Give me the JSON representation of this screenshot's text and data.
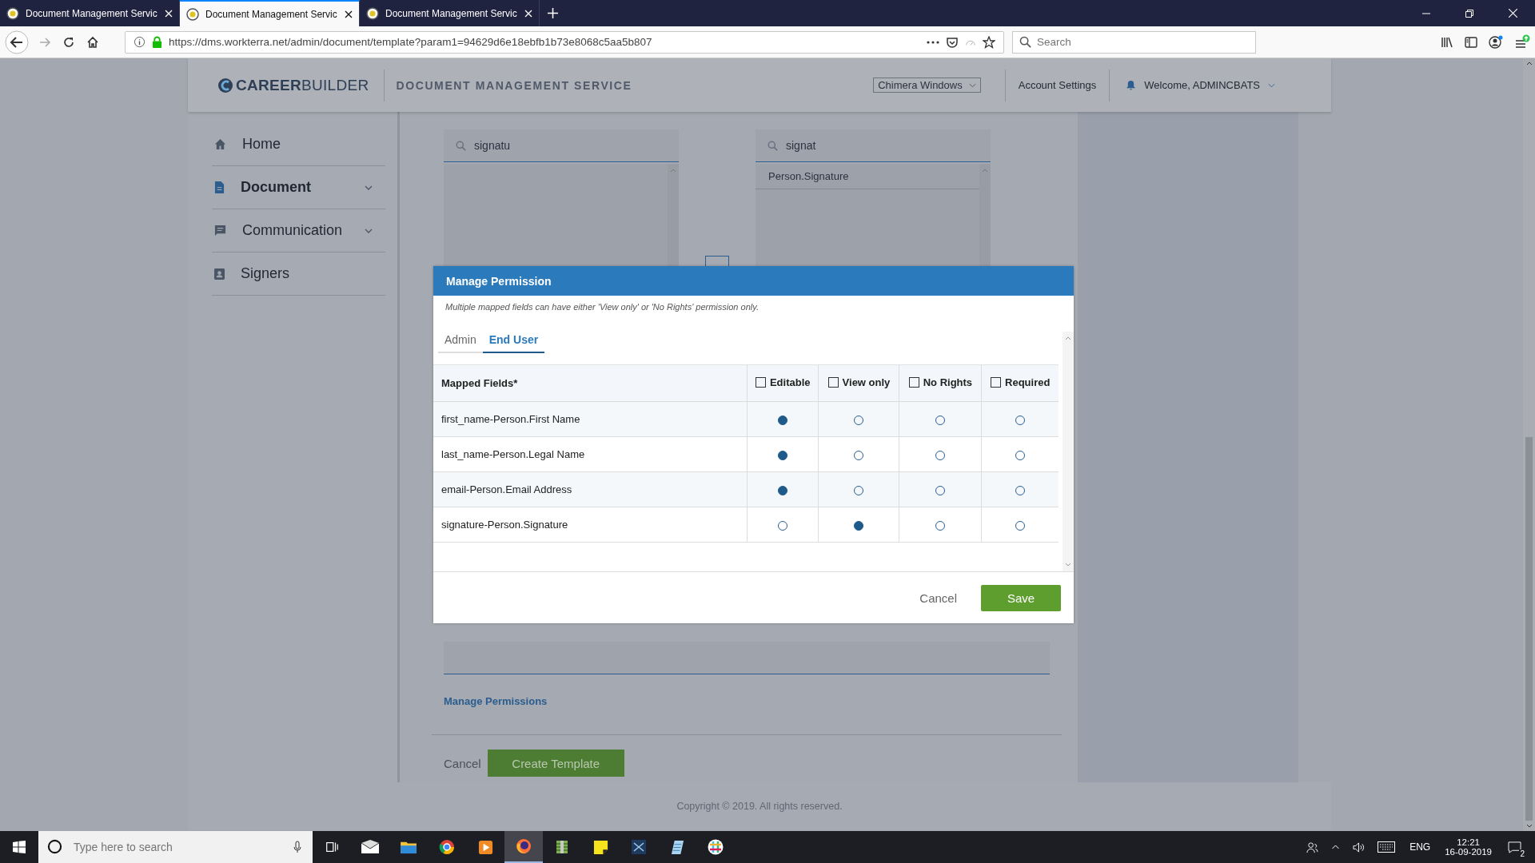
{
  "browser": {
    "tabs": [
      {
        "title": "Document Management Servic",
        "selected": false
      },
      {
        "title": "Document Management Servic",
        "selected": true
      },
      {
        "title": "Document Management Servic",
        "selected": false
      }
    ],
    "url": "https://dms.workterra.net/admin/document/template?param1=94629d6e18ebfb1b73e8068c5aa5b807",
    "search": {
      "placeholder": "Search"
    }
  },
  "header": {
    "logo": "**CAREER**BUILDER",
    "title": "DOCUMENT MANAGEMENT SERVICE",
    "workspace": "Chimera Windows",
    "account": "Account Settings",
    "welcome": "Welcome, ADMINCBATS"
  },
  "sidebar": {
    "items": [
      {
        "label": "Home",
        "kind": "home",
        "selected": false,
        "expandable": false
      },
      {
        "label": "Document",
        "kind": "document",
        "selected": true,
        "expandable": true
      },
      {
        "label": "Communication",
        "kind": "chat",
        "selected": false,
        "expandable": true
      },
      {
        "label": "Signers",
        "kind": "signers",
        "selected": false,
        "expandable": false
      }
    ]
  },
  "mapping": {
    "source": {
      "query": "signatu"
    },
    "target": {
      "query": "signat",
      "items": [
        "Person.Signature"
      ]
    }
  },
  "form": {
    "link": "Manage Permissions",
    "cancel": "Cancel",
    "create": "Create Template"
  },
  "footer": "Copyright © 2019. All rights reserved.",
  "dialog": {
    "title": "Manage Permission",
    "note": "Multiple mapped fields can have either 'View only' or 'No Rights' permission only.",
    "tabs": [
      {
        "label": "Admin",
        "selected": false
      },
      {
        "label": "End User",
        "selected": true
      }
    ],
    "field_column": "Mapped Fields*",
    "columns": [
      {
        "label": "Editable",
        "checked": false
      },
      {
        "label": "View only",
        "checked": false
      },
      {
        "label": "No Rights",
        "checked": false
      },
      {
        "label": "Required",
        "checked": false
      }
    ],
    "rows": [
      {
        "field": "first_name-Person.First Name",
        "options": [
          {
            "selected": true
          },
          {
            "selected": false
          },
          {
            "selected": false
          },
          {
            "selected": false
          }
        ]
      },
      {
        "field": "last_name-Person.Legal Name",
        "options": [
          {
            "selected": true
          },
          {
            "selected": false
          },
          {
            "selected": false
          },
          {
            "selected": false
          }
        ]
      },
      {
        "field": "email-Person.Email Address",
        "options": [
          {
            "selected": true
          },
          {
            "selected": false
          },
          {
            "selected": false
          },
          {
            "selected": false
          }
        ]
      },
      {
        "field": "signature-Person.Signature",
        "options": [
          {
            "selected": false
          },
          {
            "selected": true
          },
          {
            "selected": false
          },
          {
            "selected": false
          }
        ]
      }
    ],
    "cancel": "Cancel",
    "save": "Save"
  },
  "taskbar": {
    "search_placeholder": "Type here to search",
    "apps": [
      {
        "kind": "taskview",
        "selected": false
      },
      {
        "kind": "mail",
        "selected": false
      },
      {
        "kind": "folder",
        "selected": false
      },
      {
        "kind": "chrome",
        "selected": false
      },
      {
        "kind": "media",
        "selected": false
      },
      {
        "kind": "firefox",
        "selected": true
      },
      {
        "kind": "archive",
        "selected": false
      },
      {
        "kind": "notes",
        "selected": false
      },
      {
        "kind": "vscode",
        "selected": false
      },
      {
        "kind": "paper",
        "selected": false
      },
      {
        "kind": "slack",
        "selected": false
      }
    ],
    "language": "ENG",
    "time": "12:21",
    "date": "16-09-2019",
    "notifications": "2"
  }
}
